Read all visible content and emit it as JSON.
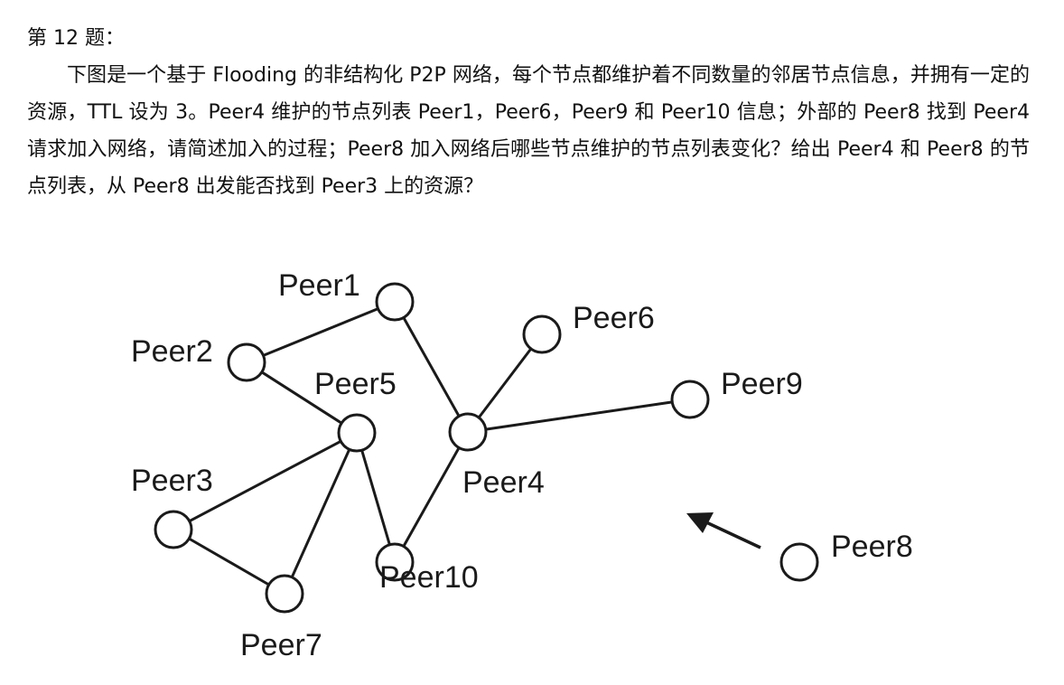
{
  "question": {
    "title": "第 12 题：",
    "body": "下图是一个基于 Flooding 的非结构化 P2P 网络，每个节点都维护着不同数量的邻居节点信息，并拥有一定的资源，TTL 设为 3。Peer4 维护的节点列表 Peer1，Peer6，Peer9 和 Peer10 信息；外部的 Peer8 找到 Peer4 请求加入网络，请简述加入的过程；Peer8 加入网络后哪些节点维护的节点列表变化？给出 Peer4 和 Peer8 的节点列表，从 Peer8 出发能否找到 Peer3 上的资源？"
  },
  "diagram": {
    "nodes": [
      {
        "id": "peer1",
        "label": "Peer1"
      },
      {
        "id": "peer2",
        "label": "Peer2"
      },
      {
        "id": "peer3",
        "label": "Peer3"
      },
      {
        "id": "peer4",
        "label": "Peer4"
      },
      {
        "id": "peer5",
        "label": "Peer5"
      },
      {
        "id": "peer6",
        "label": "Peer6"
      },
      {
        "id": "peer7",
        "label": "Peer7"
      },
      {
        "id": "peer8",
        "label": "Peer8"
      },
      {
        "id": "peer9",
        "label": "Peer9"
      },
      {
        "id": "peer10",
        "label": "Peer10"
      }
    ],
    "edges": [
      {
        "from": "peer2",
        "to": "peer1"
      },
      {
        "from": "peer2",
        "to": "peer5"
      },
      {
        "from": "peer1",
        "to": "peer4"
      },
      {
        "from": "peer6",
        "to": "peer4"
      },
      {
        "from": "peer9",
        "to": "peer4"
      },
      {
        "from": "peer4",
        "to": "peer10"
      },
      {
        "from": "peer5",
        "to": "peer10"
      },
      {
        "from": "peer5",
        "to": "peer3"
      },
      {
        "from": "peer5",
        "to": "peer7"
      },
      {
        "from": "peer3",
        "to": "peer7"
      }
    ],
    "arrow": {
      "from": "peer8",
      "to": "peer4"
    }
  }
}
